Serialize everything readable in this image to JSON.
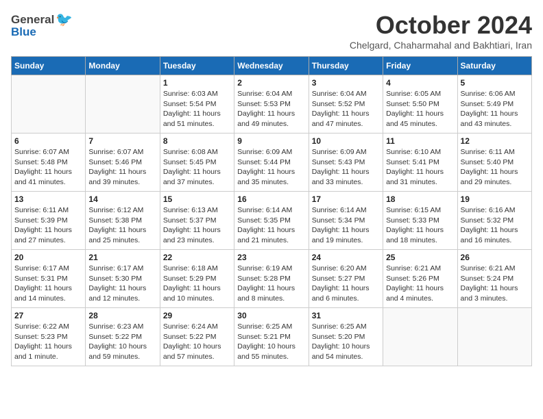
{
  "logo": {
    "text_general": "General",
    "text_blue": "Blue"
  },
  "header": {
    "month_title": "October 2024",
    "subtitle": "Chelgard, Chaharmahal and Bakhtiari, Iran"
  },
  "weekdays": [
    "Sunday",
    "Monday",
    "Tuesday",
    "Wednesday",
    "Thursday",
    "Friday",
    "Saturday"
  ],
  "weeks": [
    [
      {
        "day": "",
        "info": ""
      },
      {
        "day": "",
        "info": ""
      },
      {
        "day": "1",
        "info": "Sunrise: 6:03 AM\nSunset: 5:54 PM\nDaylight: 11 hours and 51 minutes."
      },
      {
        "day": "2",
        "info": "Sunrise: 6:04 AM\nSunset: 5:53 PM\nDaylight: 11 hours and 49 minutes."
      },
      {
        "day": "3",
        "info": "Sunrise: 6:04 AM\nSunset: 5:52 PM\nDaylight: 11 hours and 47 minutes."
      },
      {
        "day": "4",
        "info": "Sunrise: 6:05 AM\nSunset: 5:50 PM\nDaylight: 11 hours and 45 minutes."
      },
      {
        "day": "5",
        "info": "Sunrise: 6:06 AM\nSunset: 5:49 PM\nDaylight: 11 hours and 43 minutes."
      }
    ],
    [
      {
        "day": "6",
        "info": "Sunrise: 6:07 AM\nSunset: 5:48 PM\nDaylight: 11 hours and 41 minutes."
      },
      {
        "day": "7",
        "info": "Sunrise: 6:07 AM\nSunset: 5:46 PM\nDaylight: 11 hours and 39 minutes."
      },
      {
        "day": "8",
        "info": "Sunrise: 6:08 AM\nSunset: 5:45 PM\nDaylight: 11 hours and 37 minutes."
      },
      {
        "day": "9",
        "info": "Sunrise: 6:09 AM\nSunset: 5:44 PM\nDaylight: 11 hours and 35 minutes."
      },
      {
        "day": "10",
        "info": "Sunrise: 6:09 AM\nSunset: 5:43 PM\nDaylight: 11 hours and 33 minutes."
      },
      {
        "day": "11",
        "info": "Sunrise: 6:10 AM\nSunset: 5:41 PM\nDaylight: 11 hours and 31 minutes."
      },
      {
        "day": "12",
        "info": "Sunrise: 6:11 AM\nSunset: 5:40 PM\nDaylight: 11 hours and 29 minutes."
      }
    ],
    [
      {
        "day": "13",
        "info": "Sunrise: 6:11 AM\nSunset: 5:39 PM\nDaylight: 11 hours and 27 minutes."
      },
      {
        "day": "14",
        "info": "Sunrise: 6:12 AM\nSunset: 5:38 PM\nDaylight: 11 hours and 25 minutes."
      },
      {
        "day": "15",
        "info": "Sunrise: 6:13 AM\nSunset: 5:37 PM\nDaylight: 11 hours and 23 minutes."
      },
      {
        "day": "16",
        "info": "Sunrise: 6:14 AM\nSunset: 5:35 PM\nDaylight: 11 hours and 21 minutes."
      },
      {
        "day": "17",
        "info": "Sunrise: 6:14 AM\nSunset: 5:34 PM\nDaylight: 11 hours and 19 minutes."
      },
      {
        "day": "18",
        "info": "Sunrise: 6:15 AM\nSunset: 5:33 PM\nDaylight: 11 hours and 18 minutes."
      },
      {
        "day": "19",
        "info": "Sunrise: 6:16 AM\nSunset: 5:32 PM\nDaylight: 11 hours and 16 minutes."
      }
    ],
    [
      {
        "day": "20",
        "info": "Sunrise: 6:17 AM\nSunset: 5:31 PM\nDaylight: 11 hours and 14 minutes."
      },
      {
        "day": "21",
        "info": "Sunrise: 6:17 AM\nSunset: 5:30 PM\nDaylight: 11 hours and 12 minutes."
      },
      {
        "day": "22",
        "info": "Sunrise: 6:18 AM\nSunset: 5:29 PM\nDaylight: 11 hours and 10 minutes."
      },
      {
        "day": "23",
        "info": "Sunrise: 6:19 AM\nSunset: 5:28 PM\nDaylight: 11 hours and 8 minutes."
      },
      {
        "day": "24",
        "info": "Sunrise: 6:20 AM\nSunset: 5:27 PM\nDaylight: 11 hours and 6 minutes."
      },
      {
        "day": "25",
        "info": "Sunrise: 6:21 AM\nSunset: 5:26 PM\nDaylight: 11 hours and 4 minutes."
      },
      {
        "day": "26",
        "info": "Sunrise: 6:21 AM\nSunset: 5:24 PM\nDaylight: 11 hours and 3 minutes."
      }
    ],
    [
      {
        "day": "27",
        "info": "Sunrise: 6:22 AM\nSunset: 5:23 PM\nDaylight: 11 hours and 1 minute."
      },
      {
        "day": "28",
        "info": "Sunrise: 6:23 AM\nSunset: 5:22 PM\nDaylight: 10 hours and 59 minutes."
      },
      {
        "day": "29",
        "info": "Sunrise: 6:24 AM\nSunset: 5:22 PM\nDaylight: 10 hours and 57 minutes."
      },
      {
        "day": "30",
        "info": "Sunrise: 6:25 AM\nSunset: 5:21 PM\nDaylight: 10 hours and 55 minutes."
      },
      {
        "day": "31",
        "info": "Sunrise: 6:25 AM\nSunset: 5:20 PM\nDaylight: 10 hours and 54 minutes."
      },
      {
        "day": "",
        "info": ""
      },
      {
        "day": "",
        "info": ""
      }
    ]
  ]
}
